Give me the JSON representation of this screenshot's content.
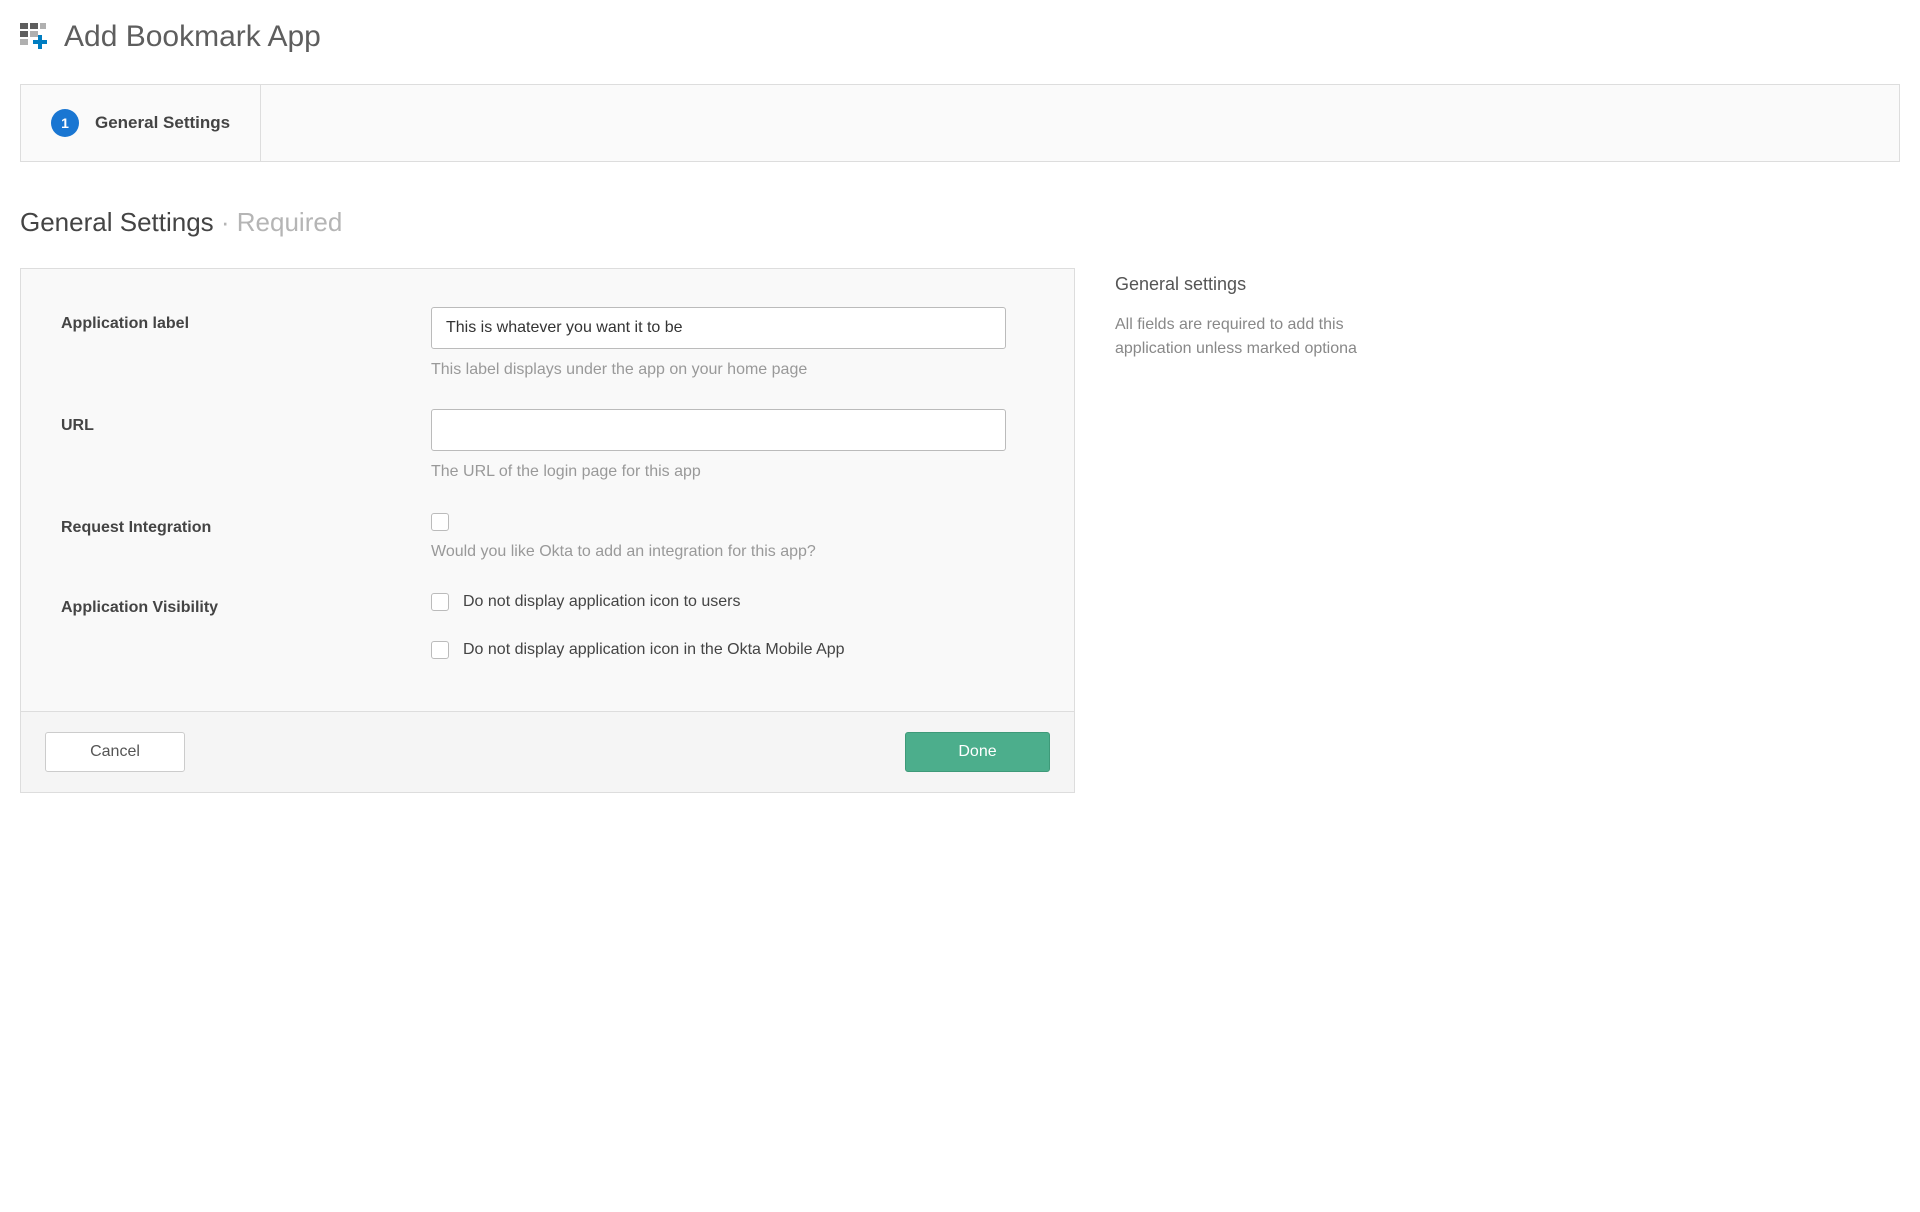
{
  "header": {
    "title": "Add Bookmark App"
  },
  "wizard": {
    "step_number": "1",
    "step_label": "General Settings"
  },
  "section": {
    "title": "General Settings",
    "suffix": " · Required"
  },
  "form": {
    "app_label": {
      "label": "Application label",
      "value": "This is whatever you want it to be",
      "help": "This label displays under the app on your home page"
    },
    "url": {
      "label": "URL",
      "value": "",
      "help": "The URL of the login page for this app"
    },
    "request_integration": {
      "label": "Request Integration",
      "help": "Would you like Okta to add an integration for this app?"
    },
    "visibility": {
      "label": "Application Visibility",
      "option1": "Do not display application icon to users",
      "option2": "Do not display application icon in the Okta Mobile App"
    }
  },
  "footer": {
    "cancel": "Cancel",
    "done": "Done"
  },
  "sidebar": {
    "title": "General settings",
    "text": "All fields are required to add this application unless marked optiona"
  }
}
